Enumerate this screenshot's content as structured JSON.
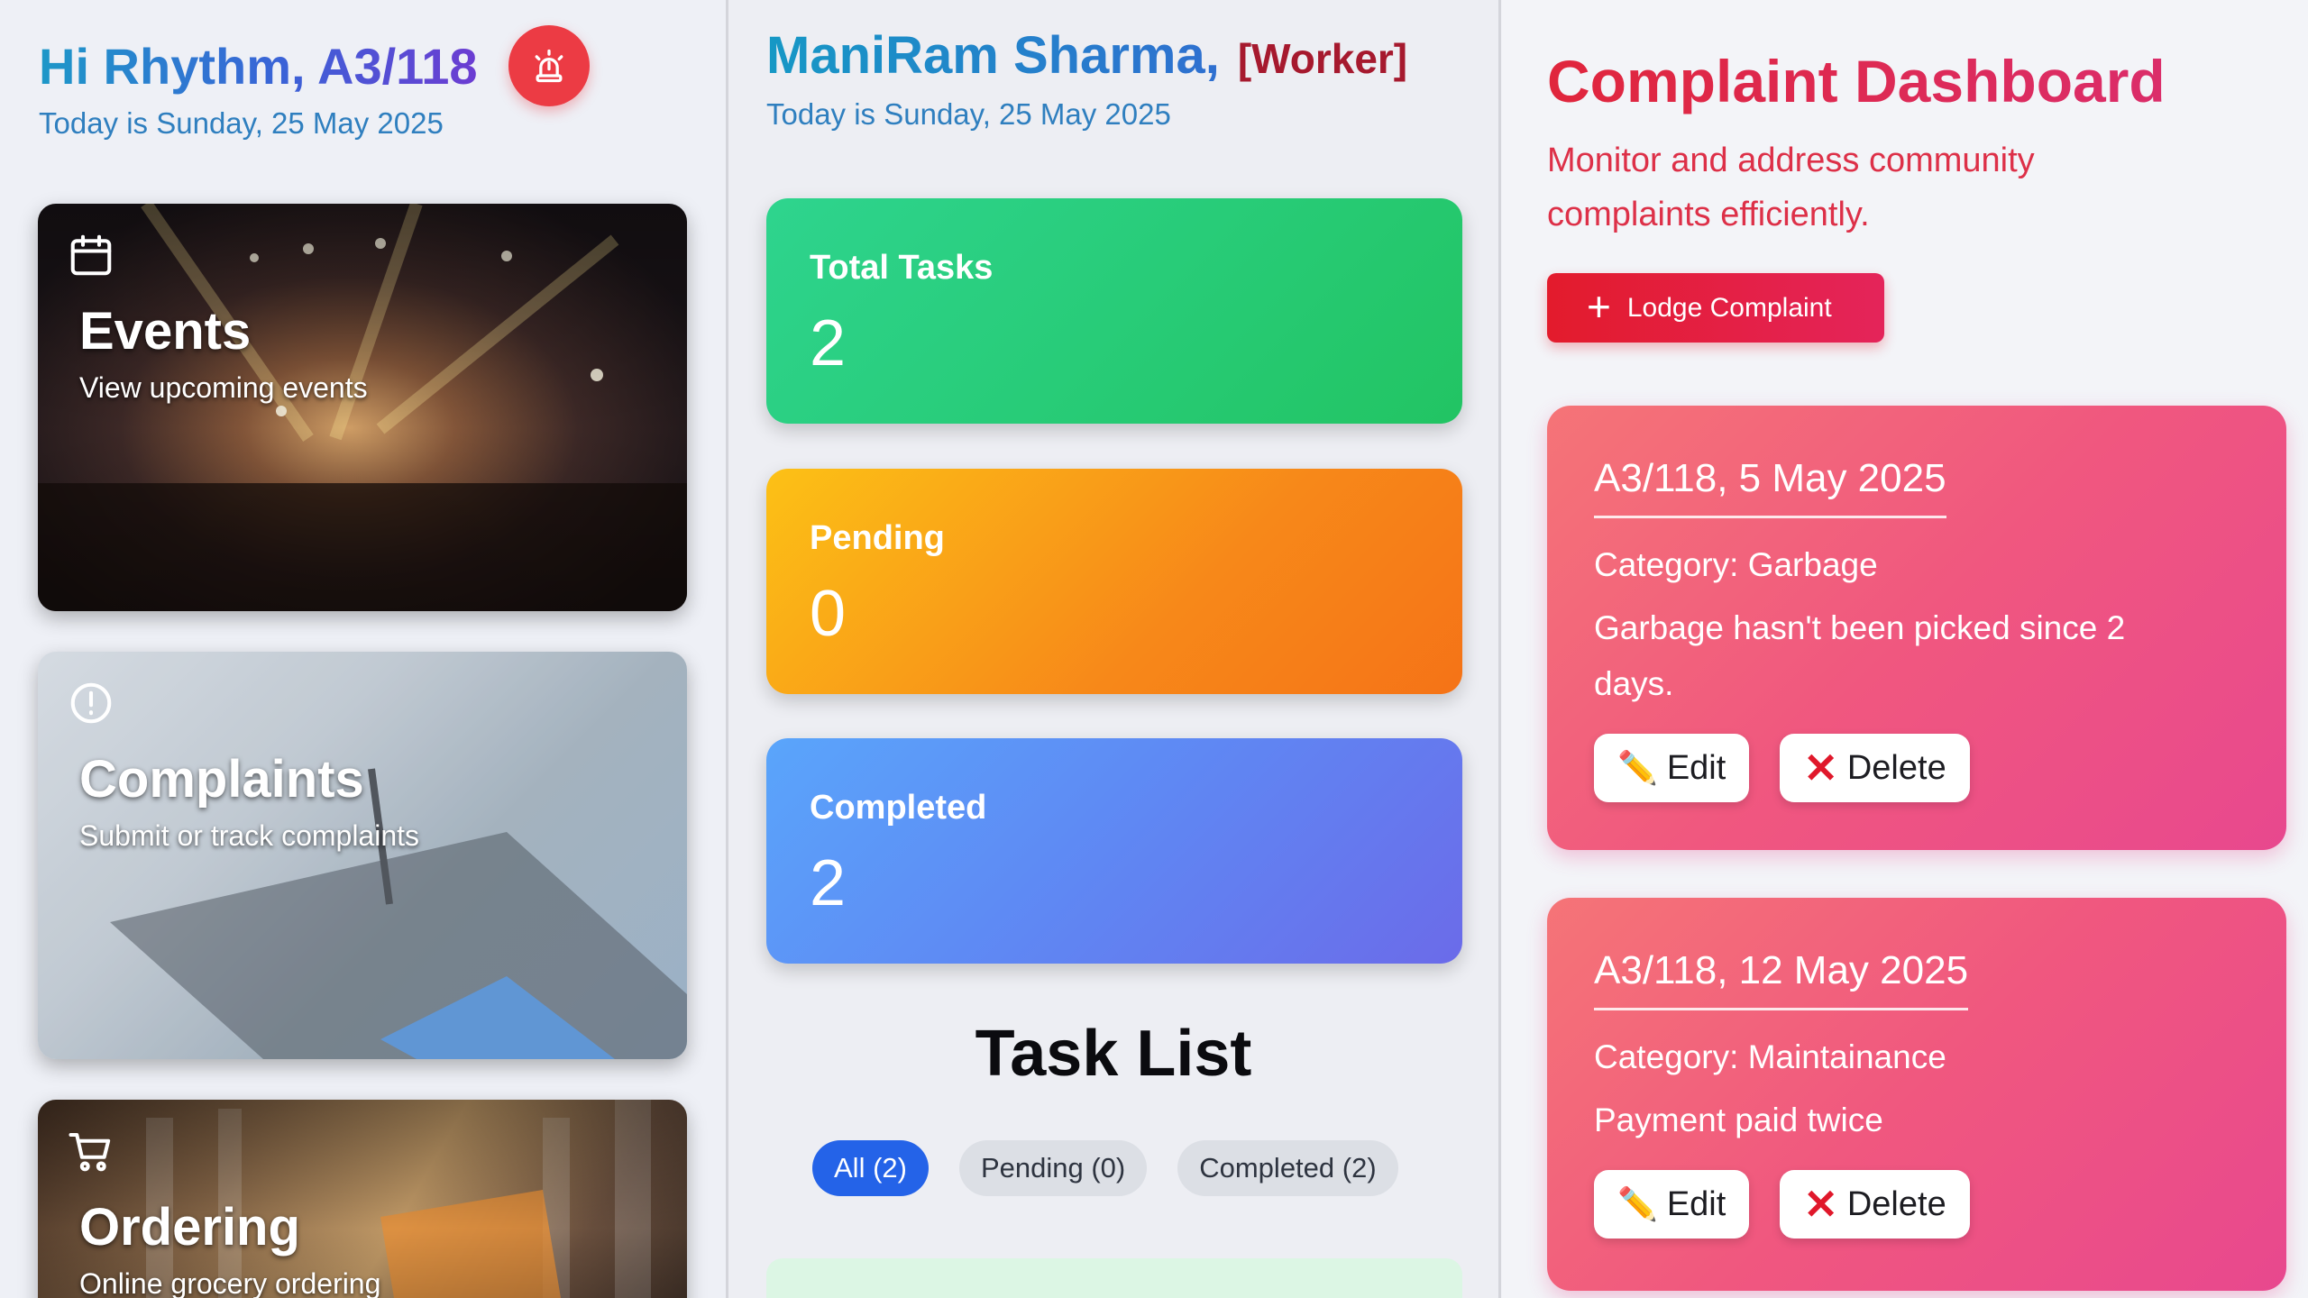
{
  "resident": {
    "greeting": "Hi Rhythm, A3/118",
    "date_line": "Today is Sunday, 25 May 2025",
    "alarm_icon": "alarm-siren-icon",
    "cards": [
      {
        "title": "Events",
        "subtitle": "View upcoming events",
        "icon": "calendar-icon"
      },
      {
        "title": "Complaints",
        "subtitle": "Submit or track complaints",
        "icon": "alert-circle-icon"
      },
      {
        "title": "Ordering",
        "subtitle": "Online grocery ordering",
        "icon": "cart-icon"
      }
    ]
  },
  "worker": {
    "name": "ManiRam Sharma,",
    "role": "[Worker]",
    "date_line": "Today is Sunday, 25 May 2025",
    "stats": [
      {
        "label": "Total Tasks",
        "value": "2"
      },
      {
        "label": "Pending",
        "value": "0"
      },
      {
        "label": "Completed",
        "value": "2"
      }
    ],
    "task_list_title": "Task List",
    "filters": [
      {
        "label": "All (2)",
        "active": true
      },
      {
        "label": "Pending (0)",
        "active": false
      },
      {
        "label": "Completed (2)",
        "active": false
      }
    ]
  },
  "complaints_dashboard": {
    "title": "Complaint Dashboard",
    "subtitle": "Monitor and address community complaints efficiently.",
    "lodge_button": "Lodge Complaint",
    "edit_label": "Edit",
    "delete_label": "Delete",
    "items": [
      {
        "header": "A3/118, 5 May 2025",
        "category": "Category: Garbage",
        "description": "Garbage hasn't been picked since 2 days."
      },
      {
        "header": "A3/118, 12 May 2025",
        "category": "Category: Maintainance",
        "description": "Payment paid twice"
      }
    ]
  },
  "colors": {
    "accent_blue": "#2463e8",
    "alarm_red": "#ec3b44",
    "stat_green": "#22c463",
    "stat_orange": "#f78819",
    "stat_blue": "#5f87f3",
    "complaint_pink": "#f0577f",
    "worker_role": "#a6192e"
  }
}
